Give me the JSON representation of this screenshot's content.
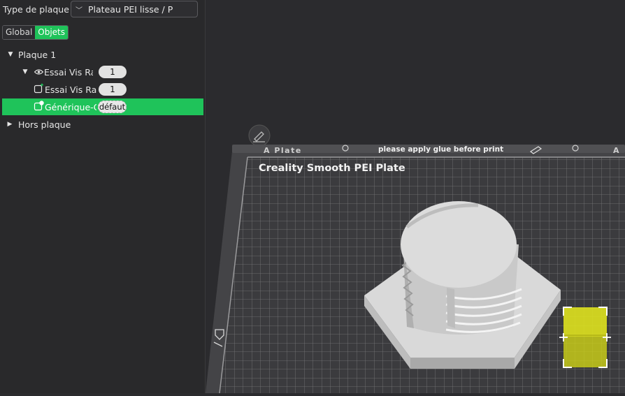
{
  "panel": {
    "plate_type_label": "Type de plaque",
    "plate_type_value": "Plateau PEI lisse / P",
    "tabs": [
      {
        "label": "Global",
        "active": false
      },
      {
        "label": "Objets",
        "active": true
      }
    ]
  },
  "tree": {
    "plate": "Plaque 1",
    "object_name": "Essai Vis Rap",
    "object_count": "1",
    "part_name": "Essai Vis Rap",
    "part_count": "1",
    "modifier_name": "Générique-C",
    "modifier_badge": "défaut",
    "outside": "Hors plaque"
  },
  "viewport": {
    "plate_tab_left": "A Plate",
    "plate_tab_right": "A",
    "plate_notice": "please apply glue before print",
    "plate_brand": "Creality Smooth PEI Plate"
  },
  "colors": {
    "accent": "#1fc35a",
    "plate": "#3a3a3c",
    "grid": "#8a8a8c",
    "model": "#d6d6d6",
    "selected_object": "#d8dc1c"
  }
}
